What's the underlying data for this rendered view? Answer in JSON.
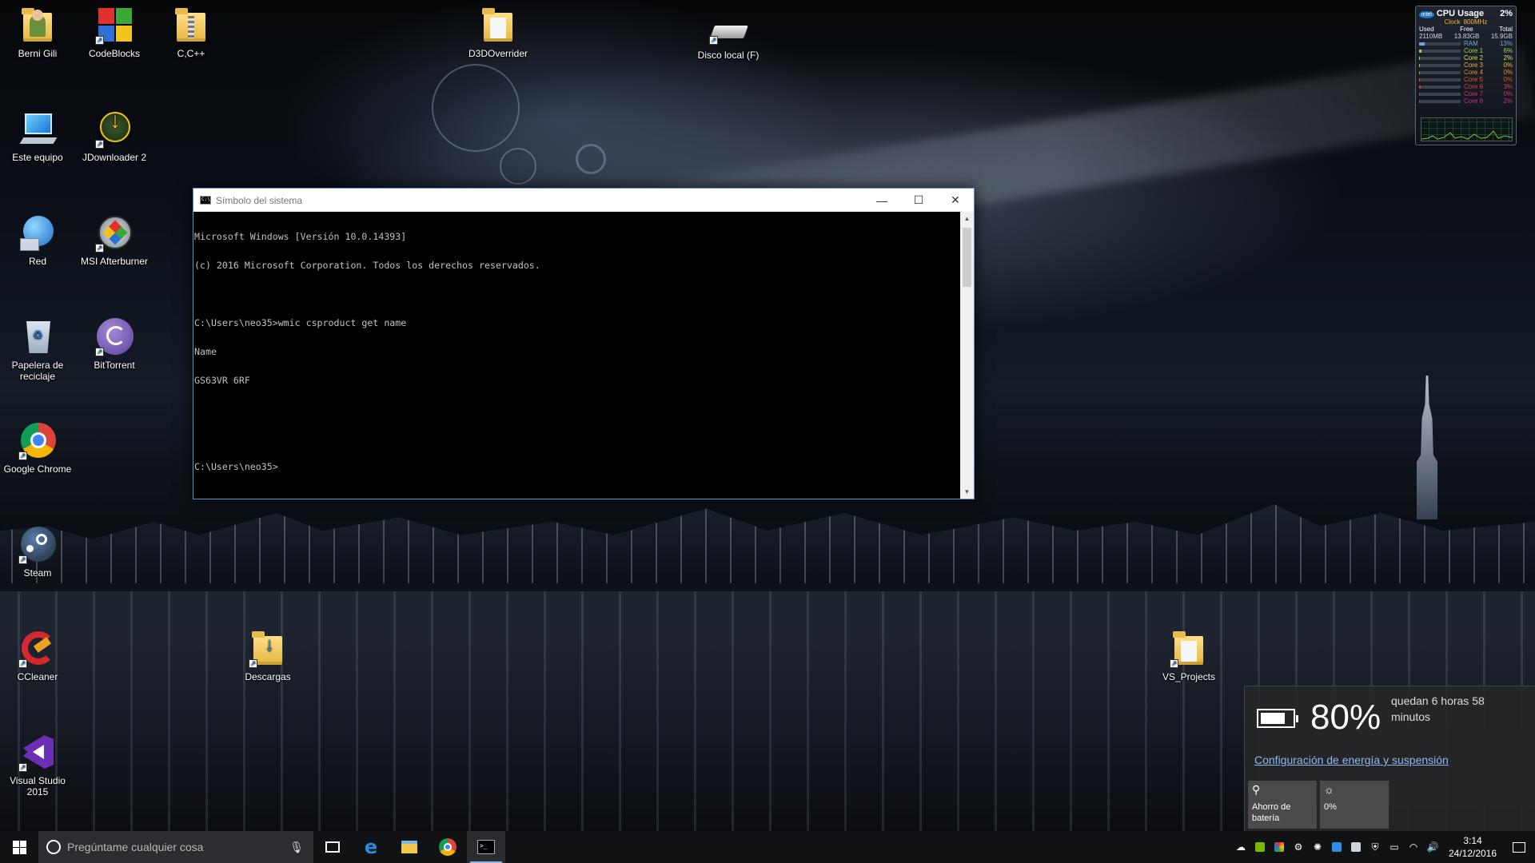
{
  "desktop": {
    "icons": [
      {
        "label": "Berni Gili",
        "icon": "user-folder-icon"
      },
      {
        "label": "CodeBlocks",
        "icon": "codeblocks-icon"
      },
      {
        "label": "C,C++",
        "icon": "zip-folder-icon"
      },
      {
        "label": "D3DOverrider",
        "icon": "folder-icon"
      },
      {
        "label": "Disco local (F)",
        "icon": "drive-icon"
      },
      {
        "label": "Este equipo",
        "icon": "computer-icon"
      },
      {
        "label": "JDownloader 2",
        "icon": "jdownloader-icon"
      },
      {
        "label": "Red",
        "icon": "network-icon"
      },
      {
        "label": "MSI Afterburner",
        "icon": "afterburner-icon"
      },
      {
        "label": "Papelera de reciclaje",
        "icon": "recycle-bin-icon"
      },
      {
        "label": "BitTorrent",
        "icon": "bittorrent-icon"
      },
      {
        "label": "Google Chrome",
        "icon": "chrome-icon"
      },
      {
        "label": "Steam",
        "icon": "steam-icon"
      },
      {
        "label": "CCleaner",
        "icon": "ccleaner-icon"
      },
      {
        "label": "Descargas",
        "icon": "downloads-folder-icon"
      },
      {
        "label": "VS_Projects",
        "icon": "folder-icon"
      },
      {
        "label": "Visual Studio 2015",
        "icon": "visual-studio-icon"
      }
    ]
  },
  "gadget": {
    "title": "CPU Usage",
    "total_pct": "2%",
    "brand": "intel",
    "clock_label": "Clock",
    "clock_value": "800MHz",
    "headers": [
      "Used",
      "Free",
      "Total"
    ],
    "values": [
      "2110MB",
      "13.83GB",
      "15.9GB"
    ],
    "rows": [
      {
        "label": "RAM",
        "value": "13%",
        "fill": 13,
        "color": "#6fa8dc"
      },
      {
        "label": "Core 1",
        "value": "6%",
        "fill": 6,
        "color": "#9fd356"
      },
      {
        "label": "Core 2",
        "value": "2%",
        "fill": 2,
        "color": "#d6e04a"
      },
      {
        "label": "Core 3",
        "value": "0%",
        "fill": 0,
        "color": "#f2b134"
      },
      {
        "label": "Core 4",
        "value": "0%",
        "fill": 0,
        "color": "#f08a24"
      },
      {
        "label": "Core 5",
        "value": "0%",
        "fill": 0,
        "color": "#e8552e"
      },
      {
        "label": "Core 6",
        "value": "3%",
        "fill": 3,
        "color": "#e03a48"
      },
      {
        "label": "Core 7",
        "value": "0%",
        "fill": 0,
        "color": "#d62f6a"
      },
      {
        "label": "Core 8",
        "value": "2%",
        "fill": 2,
        "color": "#c9308f"
      }
    ]
  },
  "cmd": {
    "title": "Símbolo del sistema",
    "lines": [
      "Microsoft Windows [Versión 10.0.14393]",
      "(c) 2016 Microsoft Corporation. Todos los derechos reservados.",
      "",
      "C:\\Users\\neo35>wmic csproduct get name",
      "Name",
      "GS63VR 6RF",
      "",
      "",
      "C:\\Users\\neo35>"
    ]
  },
  "battery": {
    "percent": "80%",
    "level": 80,
    "remaining": "quedan 6 horas 58 minutos",
    "settings_link": "Configuración de energía y suspensión",
    "tiles": [
      {
        "label": "Ahorro de batería",
        "icon": "battery-saver-icon"
      },
      {
        "label": "0%",
        "icon": "brightness-icon"
      }
    ]
  },
  "taskbar": {
    "search_placeholder": "Pregúntame cualquier cosa",
    "apps": [
      "task-view",
      "edge",
      "file-explorer",
      "chrome",
      "command-prompt"
    ],
    "active_app": "command-prompt",
    "time": "3:14",
    "date": "24/12/2016"
  }
}
